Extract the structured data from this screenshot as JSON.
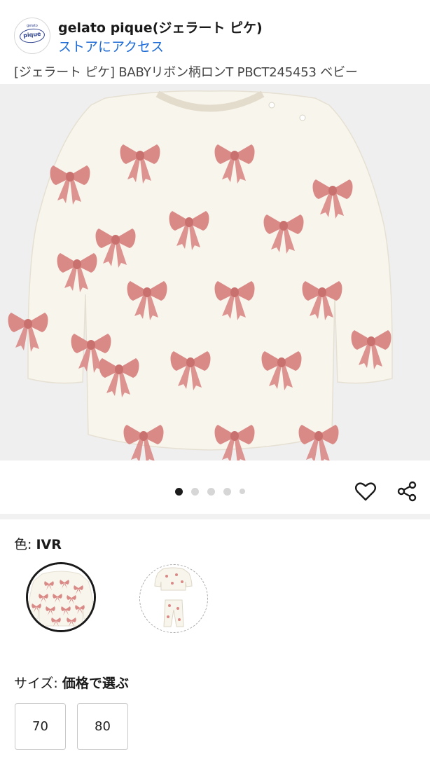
{
  "store": {
    "logo_text": "pique",
    "logo_small_text": "gelato",
    "name": "gelato pique(ジェラート ピケ)",
    "link": "ストアにアクセス"
  },
  "product": {
    "title": "[ジェラート ピケ] BABYリボン柄ロンT PBCT245453 ベビー"
  },
  "carousel": {
    "total": 5,
    "active_index": 0
  },
  "actions": {
    "favorite_icon": "heart-outline-icon",
    "share_icon": "share-icon"
  },
  "color": {
    "label": "色: ",
    "value": "IVR",
    "options": [
      "tshirt-swatch",
      "set-swatch"
    ],
    "selected": 0
  },
  "size": {
    "label": "サイズ: ",
    "value": "価格で選ぶ",
    "options": [
      "70",
      "80"
    ]
  },
  "colors": {
    "link": "#1e6bd6",
    "bow": "#d98a87",
    "shirt": "#f8f5ec",
    "background": "#efefef"
  }
}
